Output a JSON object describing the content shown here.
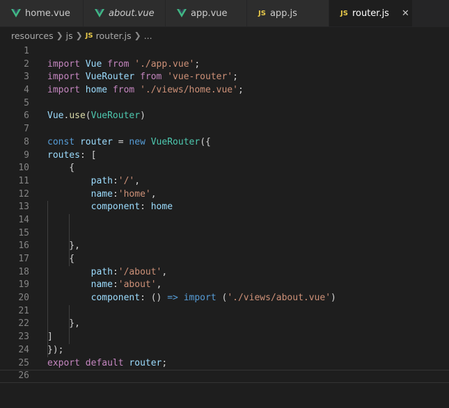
{
  "tabs": [
    {
      "label": "home.vue",
      "icon": "vue-icon",
      "active": false,
      "italic": false
    },
    {
      "label": "about.vue",
      "icon": "vue-icon",
      "active": false,
      "italic": true
    },
    {
      "label": "app.vue",
      "icon": "vue-icon",
      "active": false,
      "italic": false
    },
    {
      "label": "app.js",
      "icon": "js-icon",
      "icon_text": "JS",
      "active": false,
      "italic": false
    },
    {
      "label": "router.js",
      "icon": "js-icon",
      "icon_text": "JS",
      "active": true,
      "italic": false
    }
  ],
  "breadcrumb": {
    "folder1": "resources",
    "folder2": "js",
    "file_icon_text": "JS",
    "file": "router.js",
    "ellipsis": "..."
  },
  "colors": {
    "vue_green": "#41b883",
    "js_yellow": "#e8c94a",
    "keyword": "#c586c0",
    "storage": "#569cd6",
    "string": "#ce9178",
    "variable": "#9cdcfe",
    "class": "#4ec9b0",
    "function": "#dcdcaa"
  },
  "editor": {
    "current_line": 26,
    "lines": [
      {
        "n": "1",
        "tokens": []
      },
      {
        "n": "2",
        "tokens": [
          [
            "kw",
            "import"
          ],
          [
            "var",
            " Vue"
          ],
          [
            "kw",
            " from"
          ],
          [
            "plain",
            " "
          ],
          [
            "str",
            "'./app.vue'"
          ],
          [
            "plain",
            ";"
          ]
        ]
      },
      {
        "n": "3",
        "tokens": [
          [
            "kw",
            "import"
          ],
          [
            "var",
            " VueRouter"
          ],
          [
            "kw",
            " from"
          ],
          [
            "plain",
            " "
          ],
          [
            "str",
            "'vue-router'"
          ],
          [
            "plain",
            ";"
          ]
        ]
      },
      {
        "n": "4",
        "tokens": [
          [
            "kw",
            "import"
          ],
          [
            "var",
            " home"
          ],
          [
            "kw",
            " from"
          ],
          [
            "plain",
            " "
          ],
          [
            "str",
            "'./views/home.vue'"
          ],
          [
            "plain",
            ";"
          ]
        ]
      },
      {
        "n": "5",
        "tokens": []
      },
      {
        "n": "6",
        "tokens": [
          [
            "var",
            "Vue"
          ],
          [
            "plain",
            "."
          ],
          [
            "fn",
            "use"
          ],
          [
            "plain",
            "("
          ],
          [
            "cls",
            "VueRouter"
          ],
          [
            "plain",
            ")"
          ]
        ]
      },
      {
        "n": "7",
        "tokens": []
      },
      {
        "n": "8",
        "tokens": [
          [
            "kw2",
            "const"
          ],
          [
            "var",
            " router"
          ],
          [
            "plain",
            " = "
          ],
          [
            "kw2",
            "new"
          ],
          [
            "plain",
            " "
          ],
          [
            "cls",
            "VueRouter"
          ],
          [
            "plain",
            "({"
          ]
        ]
      },
      {
        "n": "9",
        "tokens": [
          [
            "var",
            "routes"
          ],
          [
            "plain",
            ": ["
          ]
        ]
      },
      {
        "n": "10",
        "tokens": [
          [
            "plain",
            "    {"
          ]
        ]
      },
      {
        "n": "11",
        "tokens": [
          [
            "plain",
            "        "
          ],
          [
            "var",
            "path"
          ],
          [
            "plain",
            ":"
          ],
          [
            "str",
            "'/'"
          ],
          [
            "plain",
            ","
          ]
        ]
      },
      {
        "n": "12",
        "tokens": [
          [
            "plain",
            "        "
          ],
          [
            "var",
            "name"
          ],
          [
            "plain",
            ":"
          ],
          [
            "str",
            "'home'"
          ],
          [
            "plain",
            ","
          ]
        ]
      },
      {
        "n": "13",
        "tokens": [
          [
            "plain",
            "        "
          ],
          [
            "var",
            "component"
          ],
          [
            "plain",
            ": "
          ],
          [
            "var",
            "home"
          ]
        ]
      },
      {
        "n": "14",
        "tokens": []
      },
      {
        "n": "15",
        "tokens": []
      },
      {
        "n": "16",
        "tokens": [
          [
            "plain",
            "    },"
          ]
        ]
      },
      {
        "n": "17",
        "tokens": [
          [
            "plain",
            "    {"
          ]
        ]
      },
      {
        "n": "18",
        "tokens": [
          [
            "plain",
            "        "
          ],
          [
            "var",
            "path"
          ],
          [
            "plain",
            ":"
          ],
          [
            "str",
            "'/about'"
          ],
          [
            "plain",
            ","
          ]
        ]
      },
      {
        "n": "19",
        "tokens": [
          [
            "plain",
            "        "
          ],
          [
            "var",
            "name"
          ],
          [
            "plain",
            ":"
          ],
          [
            "str",
            "'about'"
          ],
          [
            "plain",
            ","
          ]
        ]
      },
      {
        "n": "20",
        "tokens": [
          [
            "plain",
            "        "
          ],
          [
            "var",
            "component"
          ],
          [
            "plain",
            ": () "
          ],
          [
            "kw2",
            "=>"
          ],
          [
            "plain",
            " "
          ],
          [
            "kw2",
            "import"
          ],
          [
            "plain",
            " ("
          ],
          [
            "str",
            "'./views/about.vue'"
          ],
          [
            "plain",
            ")"
          ]
        ]
      },
      {
        "n": "21",
        "tokens": []
      },
      {
        "n": "22",
        "tokens": [
          [
            "plain",
            "    },"
          ]
        ]
      },
      {
        "n": "23",
        "tokens": [
          [
            "plain",
            "]"
          ]
        ]
      },
      {
        "n": "24",
        "tokens": [
          [
            "plain",
            "});"
          ]
        ]
      },
      {
        "n": "25",
        "tokens": [
          [
            "kw",
            "export"
          ],
          [
            "kw",
            " default"
          ],
          [
            "var",
            " router"
          ],
          [
            "plain",
            ";"
          ]
        ]
      },
      {
        "n": "26",
        "tokens": []
      }
    ]
  }
}
